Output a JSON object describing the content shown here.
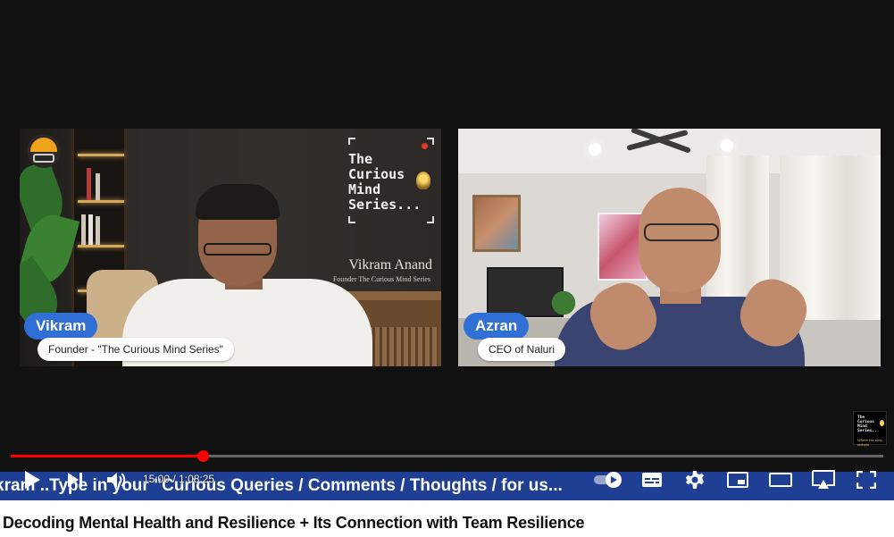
{
  "video": {
    "title": "Decoding Mental Health and Resilience + Its Connection with Team Resilience",
    "progress": 0.221,
    "time": {
      "current": "15:00",
      "separator": "/",
      "duration": "1:08:25"
    }
  },
  "frame": {
    "left": {
      "series_logo_text": "The\nCurious\nMind\nSeries...",
      "presenter_name_script": "Vikram Anand",
      "presenter_role_small": "Founder   The Curious Mind Series",
      "name_tag": "Vikram",
      "role_tag": "Founder - \"The Curious Mind Series\""
    },
    "right": {
      "name_tag": "Azran",
      "role_tag": "CEO of Naluri"
    },
    "ticker": "kram ..Type in your \"Curious Queries / Comments / Thoughts / for us...",
    "watermark_text": "The\nCurious\nMind\nSeries...",
    "watermark_tagline": "Where the story unfolds"
  },
  "controls": {
    "icons": [
      "play-icon",
      "next-icon",
      "volume-icon",
      "autoplay-toggle-icon",
      "subtitles-icon",
      "settings-icon",
      "miniplayer-icon",
      "theater-mode-icon",
      "cast-icon",
      "fullscreen-icon"
    ]
  },
  "colors": {
    "progress": "#ff0000",
    "ticker_bg": "#1e3f94",
    "name_tag_bg": "#2f6fd6"
  }
}
